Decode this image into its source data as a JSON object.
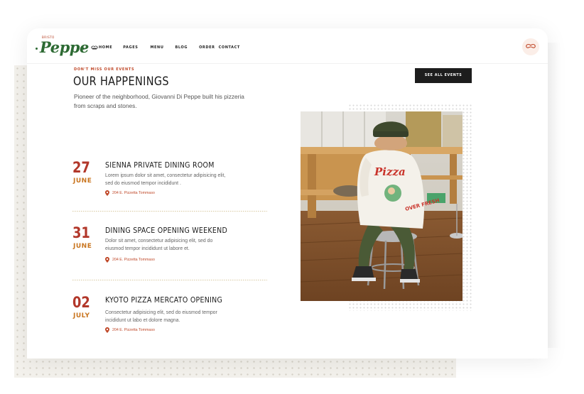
{
  "logo": {
    "small": "BRISTO",
    "word": "Peppe"
  },
  "nav": {
    "home": "HOME",
    "pages": "PAGES",
    "menu": "MENU",
    "blog": "BLOG",
    "order": "ORDER",
    "contact": "CONTACT"
  },
  "section": {
    "eyebrow": "DON'T MISS OUR EVENTS",
    "title": "OUR HAPPENINGS",
    "intro": "Pioneer of the neighborhood, Giovanni Di Peppe built his pizzeria from scraps and stones.",
    "cta": "SEE ALL EVENTS"
  },
  "events": [
    {
      "day": "27",
      "month": "JUNE",
      "title": "SIENNA PRIVATE DINING ROOM",
      "desc": "Lorem ipsum dolor sit amet, consectetur adipisicing elit, sed do eiusmod tempor incididunt .",
      "location": "204 E. Pizzetta Tommaso"
    },
    {
      "day": "31",
      "month": "JUNE",
      "title": "DINING SPACE OPENING WEEKEND",
      "desc": "Dolor sit amet, consectetur adipisicing elit, sed do eiusmod tempor incididunt ut labore et.",
      "location": "204 E. Pizzetta Tommaso"
    },
    {
      "day": "02",
      "month": "JULY",
      "title": "KYOTO PIZZA MERCATO OPENING",
      "desc": "Consectetur adipisicing elit, sed do eiusmod tempor incididunt ut labo et dolore magna.",
      "location": "204 E. Pizzetta Tommaso"
    }
  ],
  "photo": {
    "shirt_text": "Pizza",
    "shirt_subtext": "OVER FRESH"
  },
  "colors": {
    "brand_green": "#2d6a33",
    "accent_red": "#b2372a",
    "month_orange": "#c9751f",
    "button_dark": "#1d1d1d"
  },
  "icons": {
    "hat": "chef-hat-icon",
    "cart": "mustache-icon",
    "pin": "map-pin-icon"
  }
}
